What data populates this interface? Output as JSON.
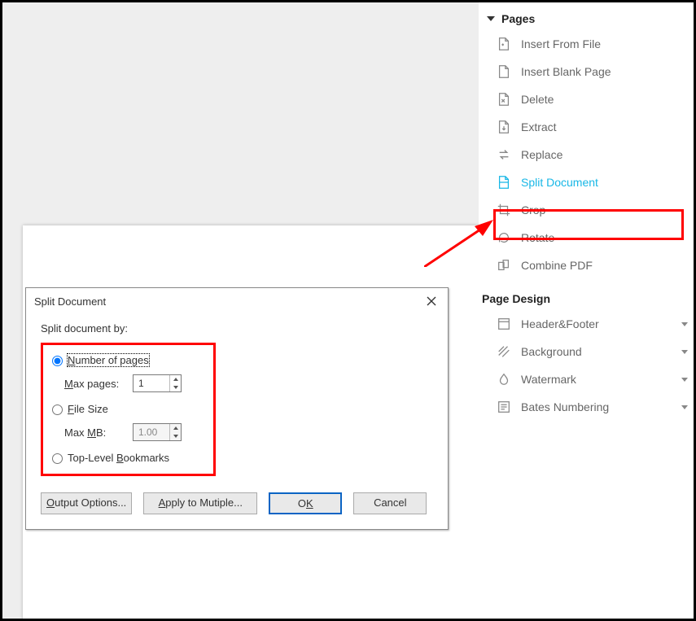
{
  "sidebar": {
    "section_pages": "Pages",
    "section_page_design": "Page Design",
    "items": [
      {
        "label": "Insert From File"
      },
      {
        "label": "Insert Blank Page"
      },
      {
        "label": "Delete"
      },
      {
        "label": "Extract"
      },
      {
        "label": "Replace"
      },
      {
        "label": "Split Document"
      },
      {
        "label": "Crop"
      },
      {
        "label": "Rotate"
      },
      {
        "label": "Combine PDF"
      }
    ],
    "design_items": [
      {
        "label": "Header&Footer"
      },
      {
        "label": "Background"
      },
      {
        "label": "Watermark"
      },
      {
        "label": "Bates Numbering"
      }
    ]
  },
  "dialog": {
    "title": "Split Document",
    "subtitle": "Split document by:",
    "opt_pages": "Number of pages",
    "opt_pages_sub": "Max pages:",
    "opt_pages_val": "1",
    "opt_filesize": "File Size",
    "opt_filesize_sub": "Max MB:",
    "opt_filesize_val": "1.00",
    "opt_bookmarks": "Top-Level Bookmarks",
    "btn_output": "Output Options...",
    "btn_apply": "Apply to Mutiple...",
    "btn_ok": "OK",
    "btn_cancel": "Cancel"
  }
}
